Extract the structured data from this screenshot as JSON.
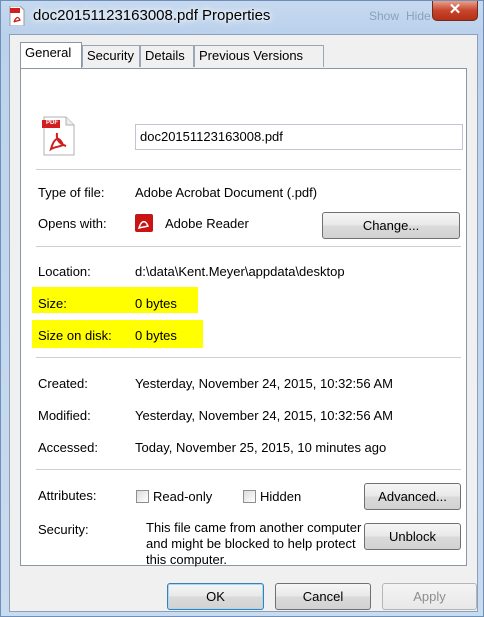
{
  "window": {
    "title": "doc20151123163008.pdf Properties",
    "ghost_items": [
      "Show",
      "Hide"
    ],
    "close_glyph": "✕"
  },
  "tabs": [
    "General",
    "Security",
    "Details",
    "Previous Versions"
  ],
  "general": {
    "filename": "doc20151123163008.pdf",
    "type_label": "Type of file:",
    "type_value": "Adobe Acrobat Document (.pdf)",
    "opens_label": "Opens with:",
    "opens_value": "Adobe Reader",
    "change_button": "Change...",
    "location_label": "Location:",
    "location_value": "d:\\data\\Kent.Meyer\\appdata\\desktop",
    "size_label": "Size:",
    "size_value": "0 bytes",
    "size_disk_label": "Size on disk:",
    "size_disk_value": "0 bytes",
    "created_label": "Created:",
    "created_value": "Yesterday, November 24, 2015, 10:32:56 AM",
    "modified_label": "Modified:",
    "modified_value": "Yesterday, November 24, 2015, 10:32:56 AM",
    "accessed_label": "Accessed:",
    "accessed_value": "Today, November 25, 2015, 10 minutes ago",
    "attributes_label": "Attributes:",
    "readonly_label": "Read-only",
    "hidden_label": "Hidden",
    "readonly_checked": false,
    "hidden_checked": false,
    "advanced_button": "Advanced...",
    "security_label": "Security:",
    "security_text": "This file came from another computer and might be blocked to help protect this computer.",
    "unblock_button": "Unblock",
    "pdf_icon_text": "PDF"
  },
  "footer": {
    "ok": "OK",
    "cancel": "Cancel",
    "apply": "Apply"
  },
  "colors": {
    "highlight": "#ffff00",
    "pdf_red": "#d21e1e",
    "accent": "#3c7fb1"
  }
}
